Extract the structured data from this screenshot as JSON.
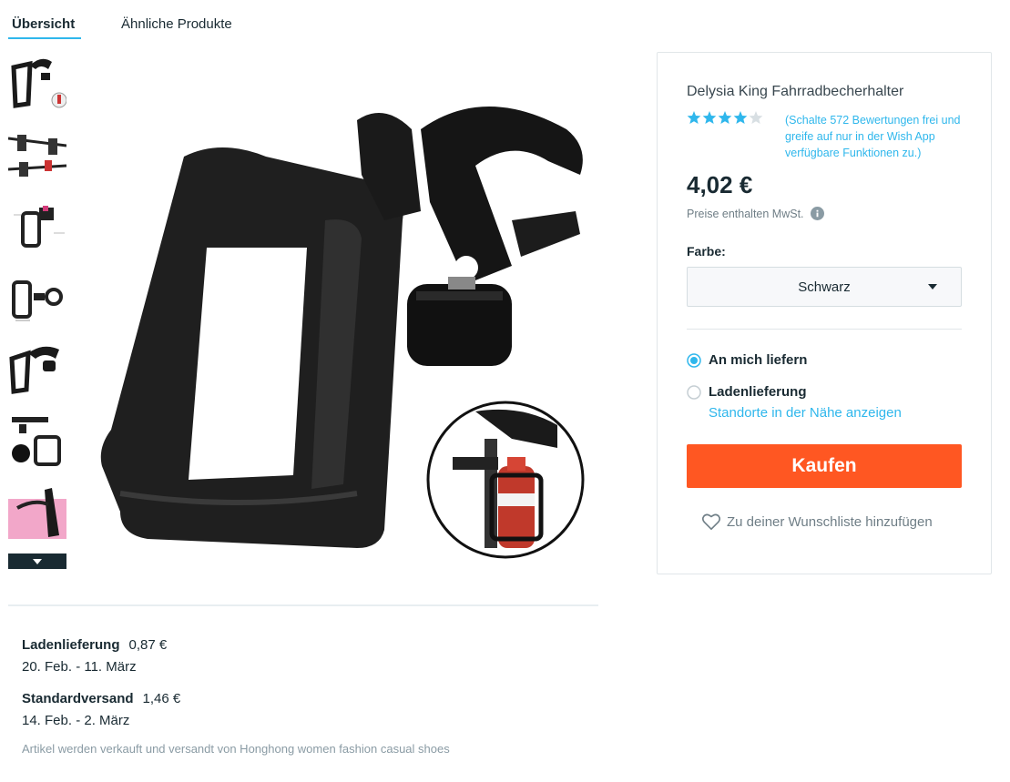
{
  "tabs": [
    {
      "label": "Übersicht",
      "active": true
    },
    {
      "label": "Ähnliche Produkte",
      "active": false
    }
  ],
  "product": {
    "title": "Delysia King Fahrradbecherhalter",
    "rating_stars": 4,
    "rating_max": 5,
    "rating_text": "(Schalte 572 Bewertungen frei und greife auf nur in der Wish App verfügbare Funktionen zu.)",
    "price": "4,02 €",
    "vat_note": "Preise enthalten MwSt.",
    "color_label": "Farbe:",
    "color_selected": "Schwarz",
    "buy_label": "Kaufen",
    "wishlist_label": "Zu deiner Wunschliste hinzufügen"
  },
  "delivery": {
    "options": [
      {
        "label": "An mich liefern",
        "selected": true
      },
      {
        "label": "Ladenlieferung",
        "selected": false
      }
    ],
    "nearby_link": "Standorte in der Nähe anzeigen"
  },
  "shipping": [
    {
      "name": "Ladenlieferung",
      "price": "0,87 €",
      "dates": "20. Feb. - 11. März"
    },
    {
      "name": "Standardversand",
      "price": "1,46 €",
      "dates": "14. Feb. - 2. März"
    }
  ],
  "seller_note": "Artikel werden verkauft und versandt von Honghong women fashion casual shoes",
  "colors": {
    "accent": "#2fb7ec",
    "buy": "#ff5722",
    "text": "#192a32",
    "muted": "#6f7e86",
    "star_empty": "#d8dfe3"
  },
  "icons": [
    "chevron-down-icon",
    "star-icon",
    "info-icon",
    "radio-icon",
    "heart-icon"
  ]
}
